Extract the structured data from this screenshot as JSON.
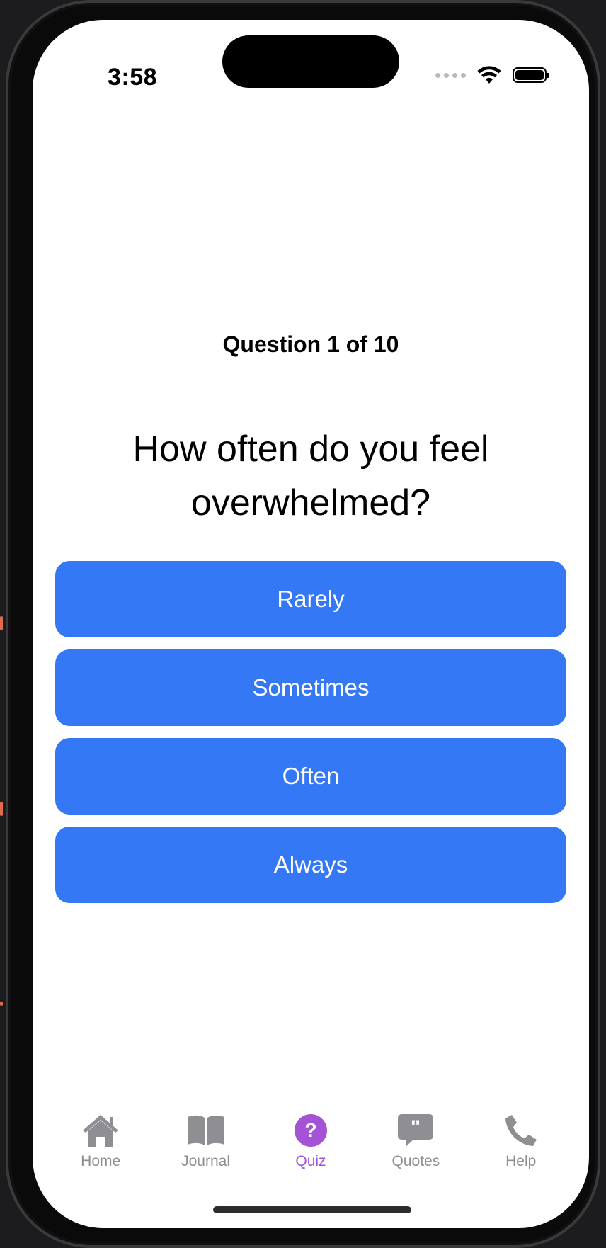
{
  "status_bar": {
    "time": "3:58"
  },
  "quiz": {
    "counter": "Question 1 of 10",
    "question": "How often do you feel overwhelmed?",
    "answers": [
      {
        "label": "Rarely"
      },
      {
        "label": "Sometimes"
      },
      {
        "label": "Often"
      },
      {
        "label": "Always"
      }
    ],
    "button_color": "#3478f6"
  },
  "tab_bar": {
    "active_color": "#a453d6",
    "inactive_color": "#8e8e93",
    "items": [
      {
        "label": "Home",
        "icon": "house-icon"
      },
      {
        "label": "Journal",
        "icon": "book-icon"
      },
      {
        "label": "Quiz",
        "icon": "question-circle-icon",
        "active": true
      },
      {
        "label": "Quotes",
        "icon": "quote-bubble-icon"
      },
      {
        "label": "Help",
        "icon": "phone-icon"
      }
    ]
  }
}
